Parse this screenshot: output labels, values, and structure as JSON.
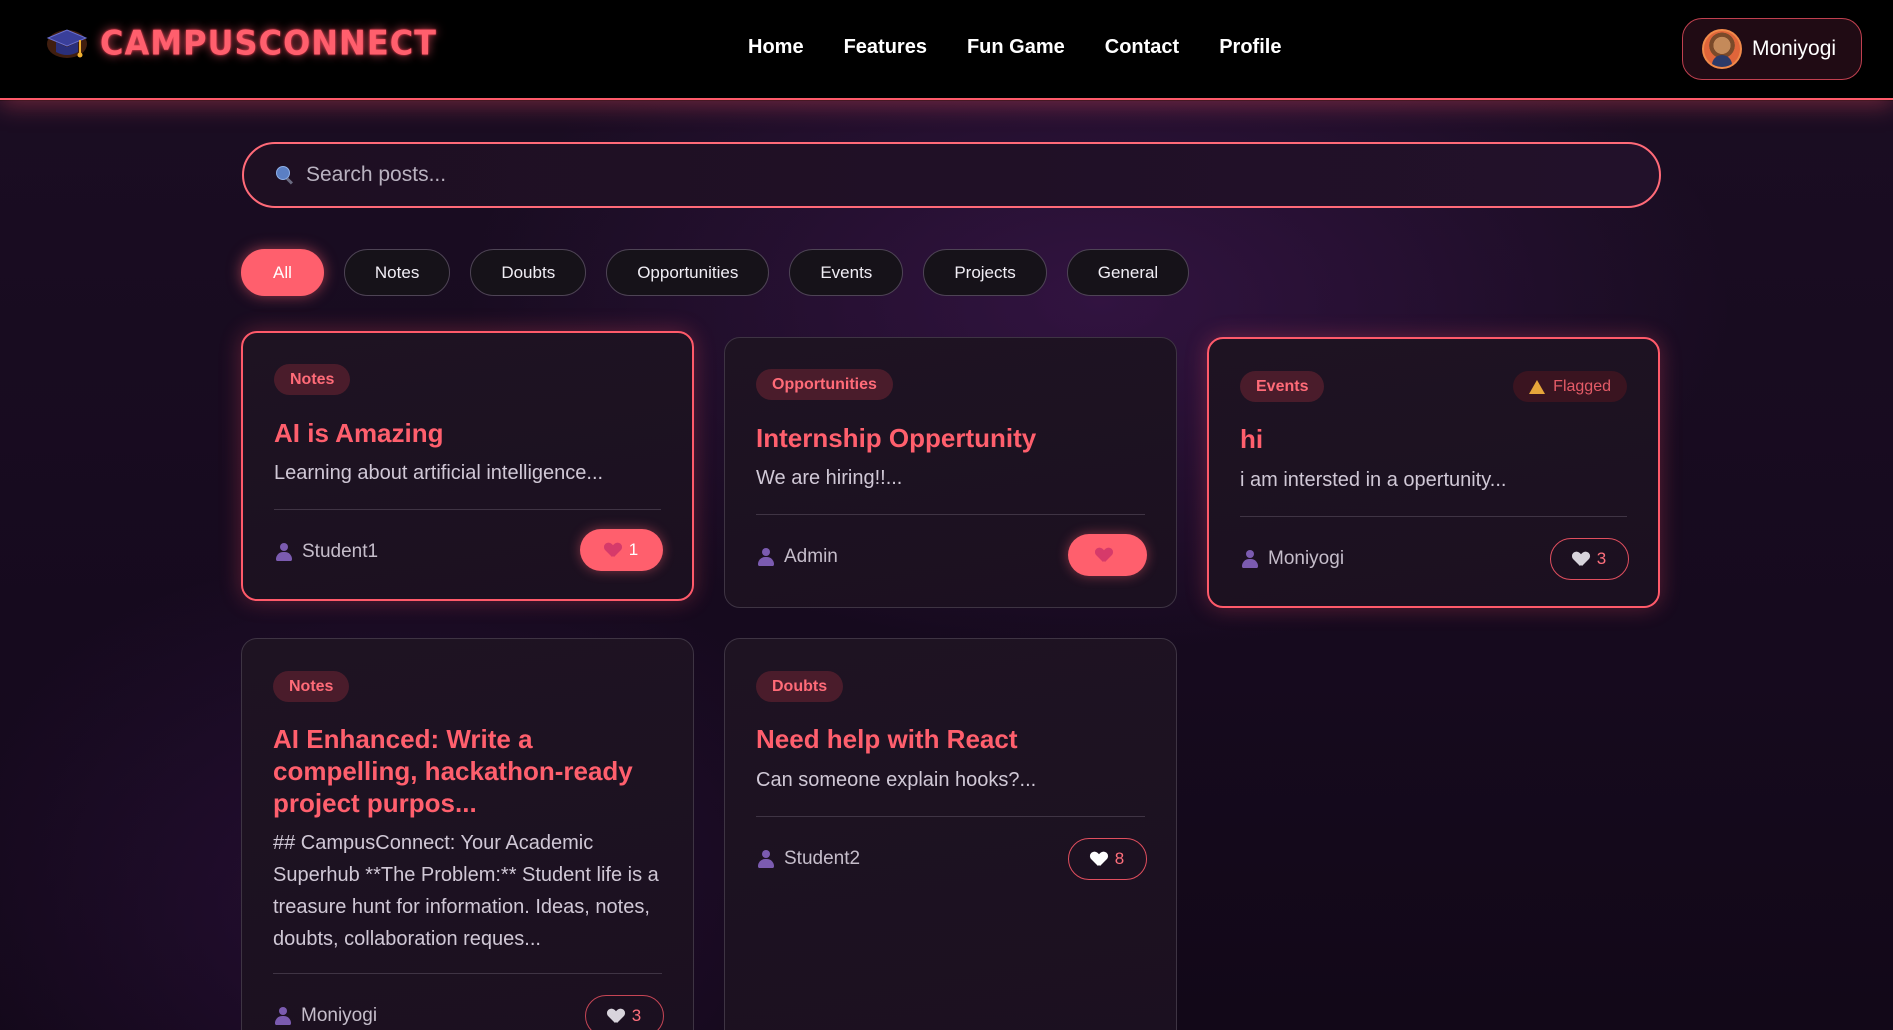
{
  "nav": {
    "brand": "CAMPUSCONNECT",
    "links": [
      "Home",
      "Features",
      "Fun Game",
      "Contact",
      "Profile"
    ],
    "profile_name": "Moniyogi"
  },
  "search": {
    "placeholder": "Search posts..."
  },
  "filters": [
    "All",
    "Notes",
    "Doubts",
    "Opportunities",
    "Events",
    "Projects",
    "General"
  ],
  "active_filter": "All",
  "posts": [
    {
      "category": "Notes",
      "title": "AI is Amazing",
      "excerpt": "Learning about artificial intelligence...",
      "author": "Student1",
      "likes": "1",
      "liked": true,
      "flagged": false
    },
    {
      "category": "Opportunities",
      "title": "Internship Oppertunity",
      "excerpt": "We are hiring!!...",
      "author": "Admin",
      "likes": "",
      "liked": true,
      "flagged": false
    },
    {
      "category": "Events",
      "title": "hi",
      "excerpt": "i am intersted in a opertunity...",
      "author": "Moniyogi",
      "likes": "3",
      "liked": false,
      "flagged": true,
      "flag_label": "Flagged"
    },
    {
      "category": "Notes",
      "title": "AI Enhanced: Write a compelling, hackathon-ready project purpos...",
      "excerpt": "## CampusConnect: Your Academic Superhub **The Problem:** Student life is a treasure hunt for information. Ideas, notes, doubts, collaboration reques...",
      "author": "Moniyogi",
      "likes": "3",
      "liked": false,
      "flagged": false
    },
    {
      "category": "Doubts",
      "title": "Need help with React",
      "excerpt": "Can someone explain hooks?...",
      "author": "Student2",
      "likes": "8",
      "liked": false,
      "flagged": false
    }
  ],
  "colors": {
    "accent": "#ff5f6d",
    "background": "#1a0d22",
    "navbar": "#000000"
  }
}
